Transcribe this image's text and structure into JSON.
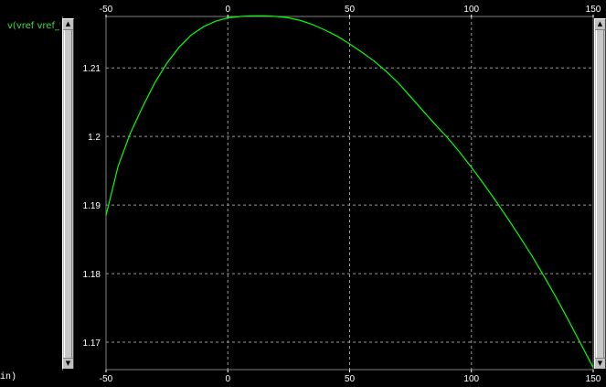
{
  "signal_panel": {
    "signal_name": "v(vref vref_t",
    "bottom_label": "in)"
  },
  "chart_data": {
    "type": "line",
    "xlim": [
      -50,
      150
    ],
    "ylim": [
      1.166,
      1.2175
    ],
    "x_ticks": [
      -50,
      0,
      50,
      100,
      150
    ],
    "y_ticks": [
      1.17,
      1.18,
      1.19,
      1.2,
      1.21
    ],
    "y_tick_labels": [
      "1.17",
      "1.18",
      "1.19",
      "1.2",
      "1.21"
    ],
    "grid": true,
    "series": [
      {
        "color": "#00ff00",
        "x": [
          -50,
          -45,
          -40,
          -35,
          -30,
          -25,
          -20,
          -15,
          -10,
          -5,
          0,
          5,
          10,
          15,
          20,
          25,
          30,
          35,
          40,
          45,
          50,
          55,
          60,
          65,
          70,
          75,
          80,
          85,
          90,
          95,
          100,
          105,
          110,
          115,
          120,
          125,
          130,
          135,
          140,
          145,
          150
        ],
        "values": [
          1.1885,
          1.1957,
          1.2005,
          1.2043,
          1.2078,
          1.2107,
          1.213,
          1.2148,
          1.216,
          1.2168,
          1.2173,
          1.2175,
          1.2176,
          1.2176,
          1.2175,
          1.2173,
          1.2169,
          1.2163,
          1.2155,
          1.2146,
          1.2135,
          1.2123,
          1.211,
          1.2095,
          1.2078,
          1.2058,
          1.2038,
          1.2018,
          1.1999,
          1.1978,
          1.1955,
          1.1931,
          1.1906,
          1.188,
          1.1853,
          1.1825,
          1.1795,
          1.1764,
          1.1731,
          1.1697,
          1.1663
        ]
      }
    ]
  }
}
